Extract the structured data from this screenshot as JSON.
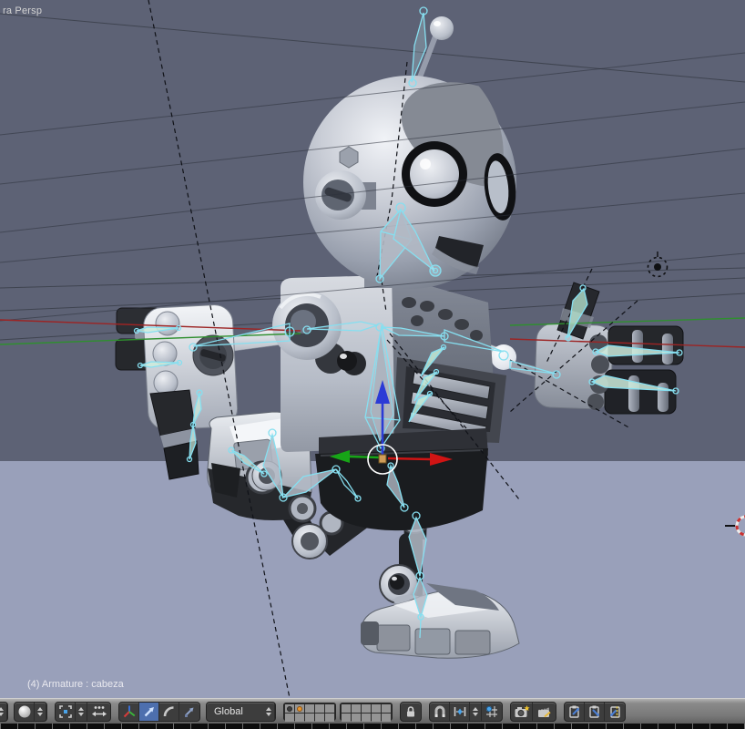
{
  "viewport": {
    "view_label": "ra Persp",
    "status_label": "(4) Armature : cabeza",
    "scene": {
      "selected_object": "Armature",
      "selected_bone": "cabeza",
      "mode": "pose",
      "objects": [
        "robot character mesh",
        "armature rig (cyan bones)",
        "lamp",
        "ground plane"
      ],
      "overlays": [
        "translate manipulator widget",
        "3d-cursor (right edge)",
        "perspective grid lines",
        "dashed constraint lines"
      ]
    }
  },
  "toolbar": {
    "orientation_label": "Global",
    "buttons": [
      "mode-spinner",
      "viewport-shading-button",
      "viewport-shading-spinner",
      "pivot-button",
      "pivot-spinner",
      "move-centers-only-button",
      "manipulator-toggle-button",
      "manipulator-translate-button",
      "manipulator-rotate-button",
      "manipulator-scale-button",
      "orientation-dropdown",
      "orientation-spinner",
      "layers-grid-1",
      "layers-grid-2",
      "lock-layers-button",
      "snap-toggle-button",
      "snap-element-button",
      "snap-element-spinner",
      "retopo-button",
      "opengl-render-button",
      "opengl-render-anim-button",
      "copy-pose-button",
      "paste-pose-button",
      "paste-flipped-pose-button"
    ],
    "active_button": "manipulator-translate-button"
  },
  "palette": {
    "world_top": "#5d6275",
    "ground_plane": "#99a0ba",
    "bone_wire": "#86dff0",
    "axis_x_red": "#9c2424",
    "axis_y_green": "#2f8f2f",
    "widget_red": "#d01414",
    "widget_green": "#17a517",
    "widget_blue": "#2b3bd6",
    "widget_center_orange": "#cf9c58",
    "header_gray": "#787878",
    "active_button_blue": "#4d6fae",
    "layer_dot_orange": "#e8962f"
  }
}
